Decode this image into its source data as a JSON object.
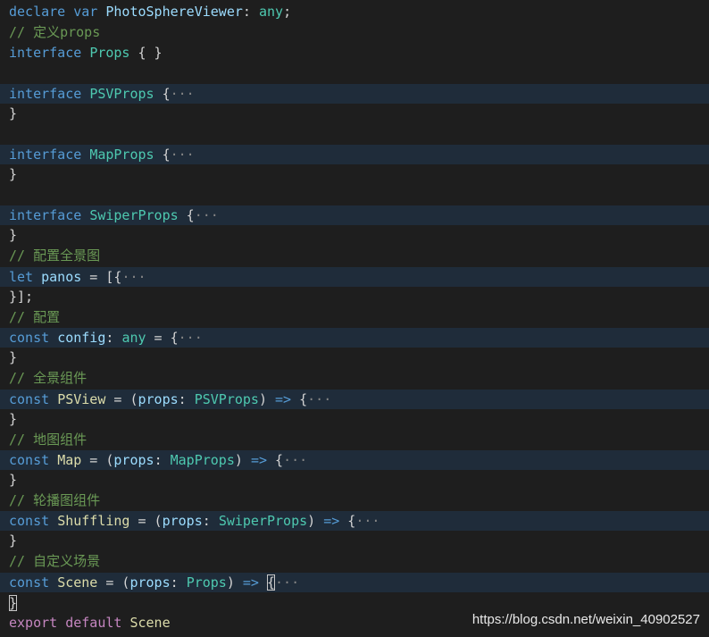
{
  "editor": {
    "lines": [
      {
        "folded": false,
        "tokens": [
          [
            "kw",
            "declare"
          ],
          [
            "p",
            " "
          ],
          [
            "kw",
            "var"
          ],
          [
            "p",
            " "
          ],
          [
            "var",
            "PhotoSphereViewer"
          ],
          [
            "p",
            ": "
          ],
          [
            "type",
            "any"
          ],
          [
            "p",
            ";"
          ]
        ]
      },
      {
        "folded": false,
        "tokens": [
          [
            "cmt",
            "// 定义props"
          ]
        ]
      },
      {
        "folded": false,
        "tokens": [
          [
            "kw",
            "interface"
          ],
          [
            "p",
            " "
          ],
          [
            "type",
            "Props"
          ],
          [
            "p",
            " { }"
          ]
        ]
      },
      {
        "folded": false,
        "tokens": []
      },
      {
        "folded": true,
        "tokens": [
          [
            "kw",
            "interface"
          ],
          [
            "p",
            " "
          ],
          [
            "type",
            "PSVProps"
          ],
          [
            "p",
            " {"
          ],
          [
            "ell",
            "···"
          ]
        ]
      },
      {
        "folded": false,
        "tokens": [
          [
            "p",
            "}"
          ]
        ]
      },
      {
        "folded": false,
        "tokens": []
      },
      {
        "folded": true,
        "tokens": [
          [
            "kw",
            "interface"
          ],
          [
            "p",
            " "
          ],
          [
            "type",
            "MapProps"
          ],
          [
            "p",
            " {"
          ],
          [
            "ell",
            "···"
          ]
        ]
      },
      {
        "folded": false,
        "tokens": [
          [
            "p",
            "}"
          ]
        ]
      },
      {
        "folded": false,
        "tokens": []
      },
      {
        "folded": true,
        "tokens": [
          [
            "kw",
            "interface"
          ],
          [
            "p",
            " "
          ],
          [
            "type",
            "SwiperProps"
          ],
          [
            "p",
            " {"
          ],
          [
            "ell",
            "···"
          ]
        ]
      },
      {
        "folded": false,
        "tokens": [
          [
            "p",
            "}"
          ]
        ]
      },
      {
        "folded": false,
        "tokens": [
          [
            "cmt",
            "// 配置全景图"
          ]
        ]
      },
      {
        "folded": true,
        "tokens": [
          [
            "kw",
            "let"
          ],
          [
            "p",
            " "
          ],
          [
            "var",
            "panos"
          ],
          [
            "p",
            " = [{"
          ],
          [
            "ell",
            "···"
          ]
        ]
      },
      {
        "folded": false,
        "tokens": [
          [
            "p",
            "}];"
          ]
        ]
      },
      {
        "folded": false,
        "tokens": [
          [
            "cmt",
            "// 配置"
          ]
        ]
      },
      {
        "folded": true,
        "tokens": [
          [
            "kw",
            "const"
          ],
          [
            "p",
            " "
          ],
          [
            "var",
            "config"
          ],
          [
            "p",
            ": "
          ],
          [
            "type",
            "any"
          ],
          [
            "p",
            " = {"
          ],
          [
            "ell",
            "···"
          ]
        ]
      },
      {
        "folded": false,
        "tokens": [
          [
            "p",
            "}"
          ]
        ]
      },
      {
        "folded": false,
        "tokens": [
          [
            "cmt",
            "// 全景组件"
          ]
        ]
      },
      {
        "folded": true,
        "tokens": [
          [
            "kw",
            "const"
          ],
          [
            "p",
            " "
          ],
          [
            "fn",
            "PSView"
          ],
          [
            "p",
            " = ("
          ],
          [
            "var",
            "props"
          ],
          [
            "p",
            ": "
          ],
          [
            "type",
            "PSVProps"
          ],
          [
            "p",
            ") "
          ],
          [
            "kw",
            "=>"
          ],
          [
            "p",
            " {"
          ],
          [
            "ell",
            "···"
          ]
        ]
      },
      {
        "folded": false,
        "tokens": [
          [
            "p",
            "}"
          ]
        ]
      },
      {
        "folded": false,
        "tokens": [
          [
            "cmt",
            "// 地图组件"
          ]
        ]
      },
      {
        "folded": true,
        "tokens": [
          [
            "kw",
            "const"
          ],
          [
            "p",
            " "
          ],
          [
            "fn",
            "Map"
          ],
          [
            "p",
            " = ("
          ],
          [
            "var",
            "props"
          ],
          [
            "p",
            ": "
          ],
          [
            "type",
            "MapProps"
          ],
          [
            "p",
            ") "
          ],
          [
            "kw",
            "=>"
          ],
          [
            "p",
            " {"
          ],
          [
            "ell",
            "···"
          ]
        ]
      },
      {
        "folded": false,
        "tokens": [
          [
            "p",
            "}"
          ]
        ]
      },
      {
        "folded": false,
        "tokens": [
          [
            "cmt",
            "// 轮播图组件"
          ]
        ]
      },
      {
        "folded": true,
        "tokens": [
          [
            "kw",
            "const"
          ],
          [
            "p",
            " "
          ],
          [
            "fn",
            "Shuffling"
          ],
          [
            "p",
            " = ("
          ],
          [
            "var",
            "props"
          ],
          [
            "p",
            ": "
          ],
          [
            "type",
            "SwiperProps"
          ],
          [
            "p",
            ") "
          ],
          [
            "kw",
            "=>"
          ],
          [
            "p",
            " {"
          ],
          [
            "ell",
            "···"
          ]
        ]
      },
      {
        "folded": false,
        "tokens": [
          [
            "p",
            "}"
          ]
        ]
      },
      {
        "folded": false,
        "tokens": [
          [
            "cmt",
            "// 自定义场景"
          ]
        ]
      },
      {
        "folded": true,
        "tokens": [
          [
            "kw",
            "const"
          ],
          [
            "p",
            " "
          ],
          [
            "fn",
            "Scene"
          ],
          [
            "p",
            " = ("
          ],
          [
            "var",
            "props"
          ],
          [
            "p",
            ": "
          ],
          [
            "type",
            "Props"
          ],
          [
            "p",
            ") "
          ],
          [
            "kw",
            "=>"
          ],
          [
            "p",
            " "
          ],
          [
            "cursor",
            "{"
          ],
          [
            "ell",
            "···"
          ]
        ]
      },
      {
        "folded": false,
        "tokens": [
          [
            "bracket",
            "}"
          ]
        ]
      },
      {
        "folded": false,
        "tokens": [
          [
            "ctrl",
            "export"
          ],
          [
            "p",
            " "
          ],
          [
            "ctrl",
            "default"
          ],
          [
            "p",
            " "
          ],
          [
            "fn",
            "Scene"
          ]
        ]
      }
    ]
  },
  "watermark": {
    "text": "https://blog.csdn.net/weixin_40902527"
  }
}
